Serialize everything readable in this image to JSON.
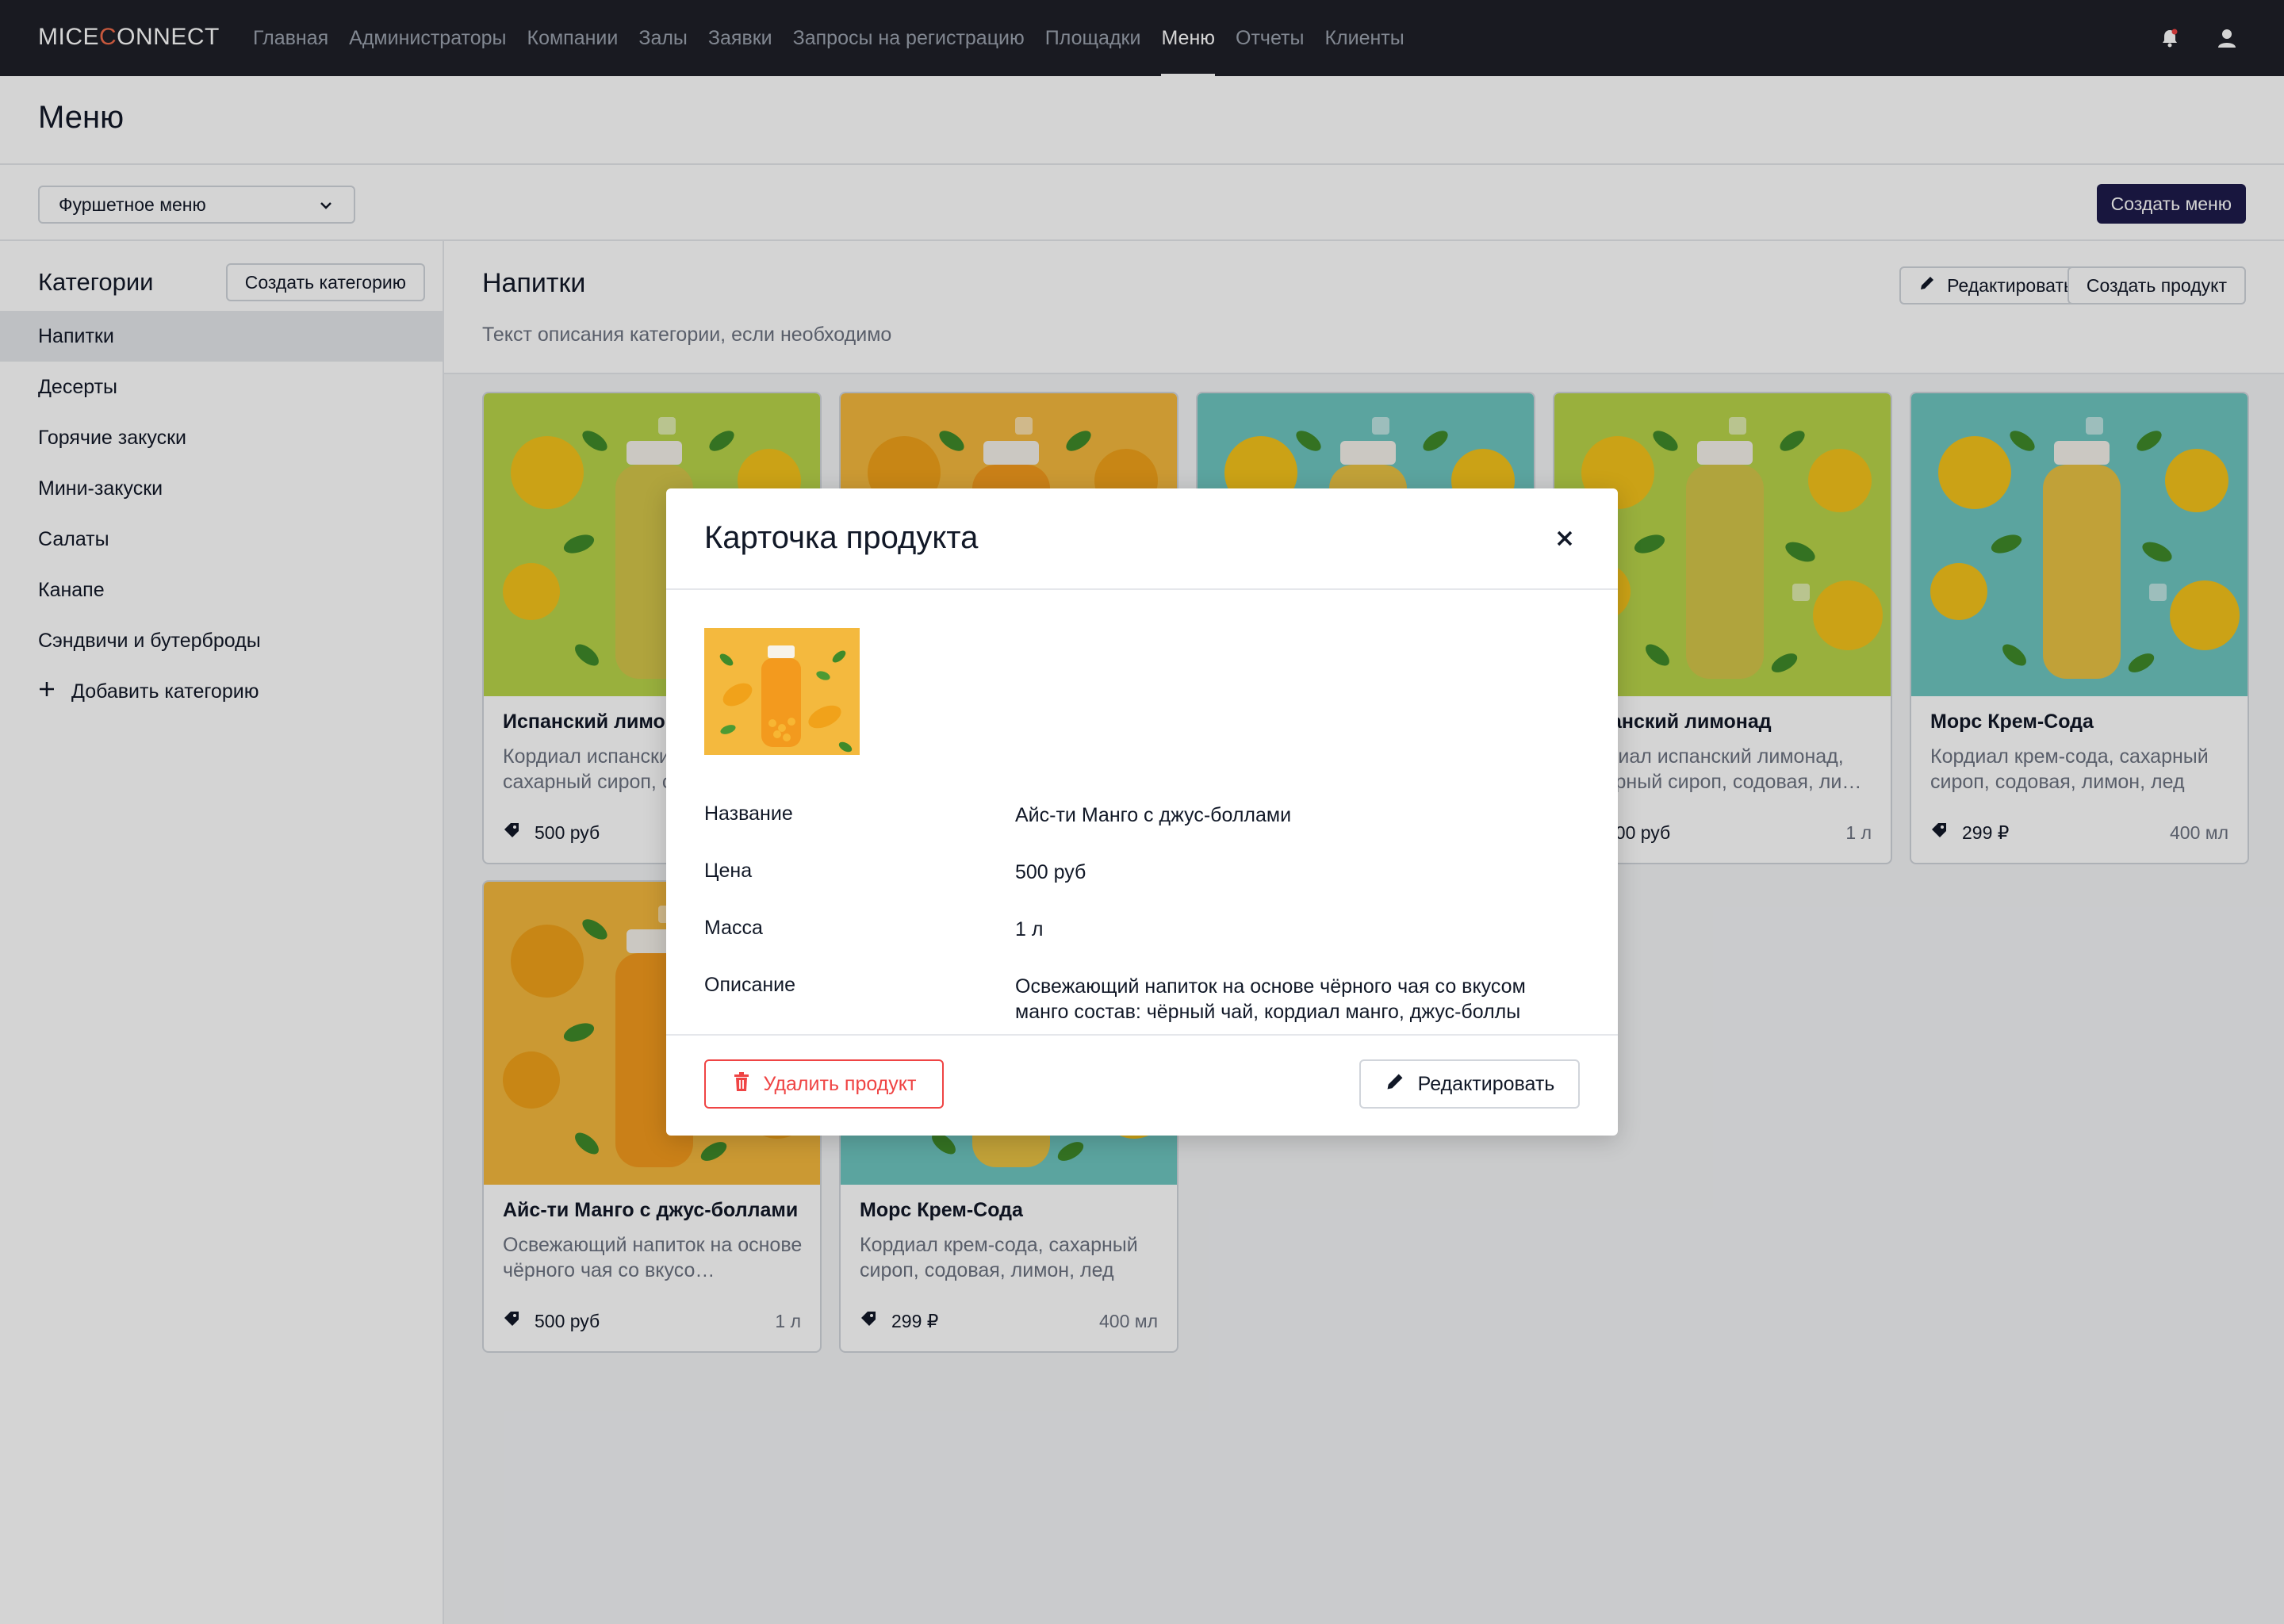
{
  "app": {
    "logo_prefix": "MICE",
    "logo_accent": "C",
    "logo_suffix": "ONNECT"
  },
  "nav": {
    "items": [
      "Главная",
      "Администраторы",
      "Компании",
      "Залы",
      "Заявки",
      "Запросы на регистрацию",
      "Площадки",
      "Меню",
      "Отчеты",
      "Клиенты"
    ],
    "active": "Меню"
  },
  "page": {
    "title": "Меню"
  },
  "toolbar": {
    "menu_select": "Фуршетное меню",
    "create_menu": "Создать меню"
  },
  "sidebar": {
    "title": "Категории",
    "create_category": "Создать категорию",
    "categories": [
      "Напитки",
      "Десерты",
      "Горячие закуски",
      "Мини-закуски",
      "Салаты",
      "Канапе",
      "Сэндвичи и бутерброды"
    ],
    "add_category": "Добавить категорию"
  },
  "category": {
    "title": "Напитки",
    "description": "Текст описания категории, если необходимо",
    "edit": "Редактировать",
    "create_product": "Создать продукт"
  },
  "products": [
    {
      "name": "Испанский лимонад",
      "desc": "Кордиал испанский лимонад, сахарный сироп, содовая, лимон, лед",
      "price": "500 руб",
      "volume": "1 л",
      "theme": "lemon-green"
    },
    {
      "name": "Айс-ти Манго с джус-боллами",
      "desc": "Освежающий напиток на основе чёрного чая со вкусом манго",
      "price": "500 руб",
      "volume": "1 л",
      "theme": "mango"
    },
    {
      "name": "Морс Крем-Сода",
      "desc": "Кордиал крем-сода, сахарный сироп, содовая, лимон, лед",
      "price": "299 ₽",
      "volume": "400 мл",
      "theme": "teal"
    },
    {
      "name": "Испанский лимонад",
      "desc": "Кордиал испанский лимонад, сахарный сироп, содовая, ли…",
      "price": "500 руб",
      "volume": "1 л",
      "theme": "lemon-green"
    },
    {
      "name": "Морс Крем-Сода",
      "desc": "Кордиал крем-сода, сахарный сироп, содовая, лимон, лед",
      "price": "299 ₽",
      "volume": "400 мл",
      "theme": "teal"
    },
    {
      "name": "Айс-ти Манго с джус-боллами",
      "desc": "Освежающий напиток на основе чёрного чая со вкусо…",
      "price": "500 руб",
      "volume": "1 л",
      "theme": "mango"
    },
    {
      "name": "Морс Крем-Сода",
      "desc": "Кордиал крем-сода, сахарный сироп, содовая, лимон, лед",
      "price": "299 ₽",
      "volume": "400 мл",
      "theme": "teal"
    }
  ],
  "modal": {
    "title": "Карточка продукта",
    "fields": [
      {
        "label": "Название",
        "value": "Айс-ти Манго с джус-боллами"
      },
      {
        "label": "Цена",
        "value": "500 руб"
      },
      {
        "label": "Масса",
        "value": "1 л"
      },
      {
        "label": "Описание",
        "value": "Освежающий напиток на основе чёрного чая со вкусом манго состав: чёрный чай, кордиал манго, джус-боллы"
      }
    ],
    "delete": "Удалить продукт",
    "edit": "Редактировать"
  },
  "colors": {
    "topbar": "#1f2028",
    "primary": "#1e1b4b",
    "danger": "#ef4444",
    "mango_bg": "#f4b93e",
    "teal_bg": "#6ec6c0",
    "lemon_bg": "#b8d44a"
  },
  "icons": [
    "bell-icon",
    "user-icon",
    "chevron-down-icon",
    "pencil-icon",
    "plus-icon",
    "tag-icon",
    "close-icon",
    "trash-icon"
  ]
}
